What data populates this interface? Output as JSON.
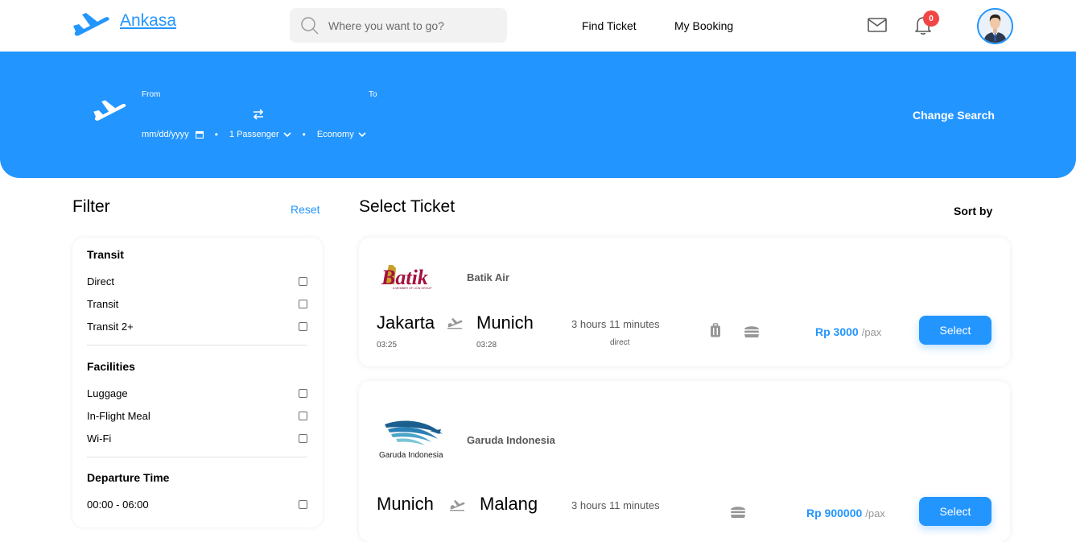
{
  "navbar": {
    "brand": "Ankasa",
    "search_placeholder": "Where you want to go?",
    "links": [
      "Find Ticket",
      "My Booking"
    ],
    "notification_count": "0"
  },
  "banner": {
    "from_label": "From",
    "to_label": "To",
    "date_placeholder": "mm/dd/yyyy",
    "passenger": "1 Passenger",
    "class": "Economy",
    "change_search": "Change Search"
  },
  "filter": {
    "title": "Filter",
    "reset": "Reset",
    "groups": [
      {
        "title": "Transit",
        "items": [
          "Direct",
          "Transit",
          "Transit 2+"
        ]
      },
      {
        "title": "Facilities",
        "items": [
          "Luggage",
          "In-Flight Meal",
          "Wi-Fi"
        ]
      },
      {
        "title": "Departure Time",
        "items": [
          "00:00 - 06:00"
        ]
      }
    ]
  },
  "tickets_header": {
    "title": "Select Ticket",
    "sort": "Sort by"
  },
  "tickets": [
    {
      "airline": "Batik Air",
      "logo_text": "Batik",
      "logo_tagline": "A MEMBER OF LION GROUP",
      "from_city": "Jakarta",
      "from_time": "03:25",
      "to_city": "Munich",
      "to_time": "03:28",
      "duration": "3 hours 11 minutes",
      "transit": "direct",
      "price": "Rp 3000",
      "per": "/pax",
      "select": "Select"
    },
    {
      "airline": "Garuda Indonesia",
      "logo_text": "Garuda Indonesia",
      "from_city": "Munich",
      "to_city": "Malang",
      "duration": "3 hours 11 minutes",
      "price": "Rp 900000",
      "per": "/pax",
      "select": "Select"
    }
  ],
  "colors": {
    "primary": "#2395ff",
    "badge": "#f24545"
  }
}
